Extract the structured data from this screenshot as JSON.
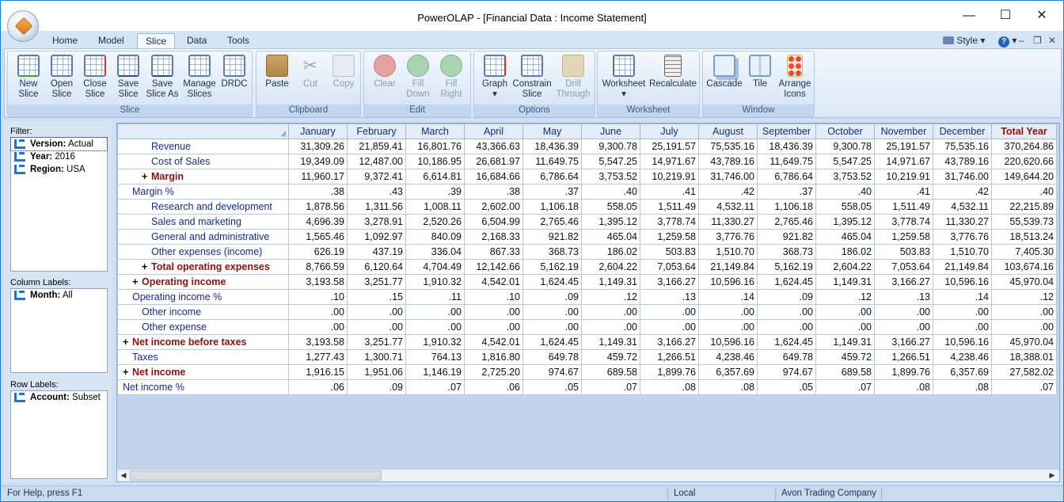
{
  "window": {
    "title": "PowerOLAP - [Financial Data : Income Statement]"
  },
  "tabs": [
    "Home",
    "Model",
    "Slice",
    "Data",
    "Tools"
  ],
  "active_tab": "Slice",
  "ribbon_right": {
    "style_label": "Style"
  },
  "ribbon": {
    "slice": {
      "label": "Slice",
      "buttons": [
        "New Slice",
        "Open Slice",
        "Close Slice",
        "Save Slice",
        "Save Slice As",
        "Manage Slices",
        "DRDC"
      ]
    },
    "clipboard": {
      "label": "Clipboard",
      "buttons": [
        "Paste",
        "Cut",
        "Copy"
      ]
    },
    "edit": {
      "label": "Edit",
      "buttons": [
        "Clear",
        "Fill Down",
        "Fill Right"
      ]
    },
    "options": {
      "label": "Options",
      "buttons": [
        "Graph",
        "Constrain Slice",
        "Drill Through"
      ]
    },
    "worksheet": {
      "label": "Worksheet",
      "buttons": [
        "Worksheet",
        "Recalculate"
      ]
    },
    "window": {
      "label": "Window",
      "buttons": [
        "Cascade",
        "Tile",
        "Arrange Icons"
      ]
    }
  },
  "panel": {
    "filter_label": "Filter:",
    "filters": [
      {
        "name": "Version:",
        "value": "Actual"
      },
      {
        "name": "Year:",
        "value": "2016"
      },
      {
        "name": "Region:",
        "value": "USA"
      }
    ],
    "column_label": "Column Labels:",
    "columns": [
      {
        "name": "Month:",
        "value": "All"
      }
    ],
    "row_label": "Row Labels:",
    "rows": [
      {
        "name": "Account:",
        "value": "Subset"
      }
    ]
  },
  "grid": {
    "headers": [
      "January",
      "February",
      "March",
      "April",
      "May",
      "June",
      "July",
      "August",
      "September",
      "October",
      "November",
      "December",
      "Total Year"
    ],
    "rows": [
      {
        "label": "Revenue",
        "indent": 3,
        "bold": false,
        "exp": false,
        "values": [
          "31,309.26",
          "21,859.41",
          "16,801.76",
          "43,366.63",
          "18,436.39",
          "9,300.78",
          "25,191.57",
          "75,535.16",
          "18,436.39",
          "9,300.78",
          "25,191.57",
          "75,535.16",
          "370,264.86"
        ]
      },
      {
        "label": "Cost of Sales",
        "indent": 3,
        "bold": false,
        "exp": false,
        "values": [
          "19,349.09",
          "12,487.00",
          "10,186.95",
          "26,681.97",
          "11,649.75",
          "5,547.25",
          "14,971.67",
          "43,789.16",
          "11,649.75",
          "5,547.25",
          "14,971.67",
          "43,789.16",
          "220,620.66"
        ]
      },
      {
        "label": "Margin",
        "indent": 2,
        "bold": true,
        "exp": true,
        "values": [
          "11,960.17",
          "9,372.41",
          "6,614.81",
          "16,684.66",
          "6,786.64",
          "3,753.52",
          "10,219.91",
          "31,746.00",
          "6,786.64",
          "3,753.52",
          "10,219.91",
          "31,746.00",
          "149,644.20"
        ]
      },
      {
        "label": "Margin %",
        "indent": 1,
        "bold": false,
        "exp": false,
        "values": [
          ".38",
          ".43",
          ".39",
          ".38",
          ".37",
          ".40",
          ".41",
          ".42",
          ".37",
          ".40",
          ".41",
          ".42",
          ".40"
        ]
      },
      {
        "label": "Research and development",
        "indent": 3,
        "bold": false,
        "exp": false,
        "values": [
          "1,878.56",
          "1,311.56",
          "1,008.11",
          "2,602.00",
          "1,106.18",
          "558.05",
          "1,511.49",
          "4,532.11",
          "1,106.18",
          "558.05",
          "1,511.49",
          "4,532.11",
          "22,215.89"
        ]
      },
      {
        "label": "Sales and marketing",
        "indent": 3,
        "bold": false,
        "exp": false,
        "values": [
          "4,696.39",
          "3,278.91",
          "2,520.26",
          "6,504.99",
          "2,765.46",
          "1,395.12",
          "3,778.74",
          "11,330.27",
          "2,765.46",
          "1,395.12",
          "3,778.74",
          "11,330.27",
          "55,539.73"
        ]
      },
      {
        "label": "General and administrative",
        "indent": 3,
        "bold": false,
        "exp": false,
        "values": [
          "1,565.46",
          "1,092.97",
          "840.09",
          "2,168.33",
          "921.82",
          "465.04",
          "1,259.58",
          "3,776.76",
          "921.82",
          "465.04",
          "1,259.58",
          "3,776.76",
          "18,513.24"
        ]
      },
      {
        "label": "Other expenses (income)",
        "indent": 3,
        "bold": false,
        "exp": false,
        "values": [
          "626.19",
          "437.19",
          "336.04",
          "867.33",
          "368.73",
          "186.02",
          "503.83",
          "1,510.70",
          "368.73",
          "186.02",
          "503.83",
          "1,510.70",
          "7,405.30"
        ]
      },
      {
        "label": "Total operating expenses",
        "indent": 2,
        "bold": true,
        "exp": true,
        "values": [
          "8,766.59",
          "6,120.64",
          "4,704.49",
          "12,142.66",
          "5,162.19",
          "2,604.22",
          "7,053.64",
          "21,149.84",
          "5,162.19",
          "2,604.22",
          "7,053.64",
          "21,149.84",
          "103,674.16"
        ]
      },
      {
        "label": "Operating income",
        "indent": 1,
        "bold": true,
        "exp": true,
        "values": [
          "3,193.58",
          "3,251.77",
          "1,910.32",
          "4,542.01",
          "1,624.45",
          "1,149.31",
          "3,166.27",
          "10,596.16",
          "1,624.45",
          "1,149.31",
          "3,166.27",
          "10,596.16",
          "45,970.04"
        ]
      },
      {
        "label": "Operating income %",
        "indent": 1,
        "bold": false,
        "exp": false,
        "values": [
          ".10",
          ".15",
          ".11",
          ".10",
          ".09",
          ".12",
          ".13",
          ".14",
          ".09",
          ".12",
          ".13",
          ".14",
          ".12"
        ]
      },
      {
        "label": "Other income",
        "indent": 2,
        "bold": false,
        "exp": false,
        "values": [
          ".00",
          ".00",
          ".00",
          ".00",
          ".00",
          ".00",
          ".00",
          ".00",
          ".00",
          ".00",
          ".00",
          ".00",
          ".00"
        ]
      },
      {
        "label": "Other expense",
        "indent": 2,
        "bold": false,
        "exp": false,
        "values": [
          ".00",
          ".00",
          ".00",
          ".00",
          ".00",
          ".00",
          ".00",
          ".00",
          ".00",
          ".00",
          ".00",
          ".00",
          ".00"
        ]
      },
      {
        "label": "Net income before taxes",
        "indent": 0,
        "bold": true,
        "exp": true,
        "values": [
          "3,193.58",
          "3,251.77",
          "1,910.32",
          "4,542.01",
          "1,624.45",
          "1,149.31",
          "3,166.27",
          "10,596.16",
          "1,624.45",
          "1,149.31",
          "3,166.27",
          "10,596.16",
          "45,970.04"
        ]
      },
      {
        "label": "Taxes",
        "indent": 1,
        "bold": false,
        "exp": false,
        "values": [
          "1,277.43",
          "1,300.71",
          "764.13",
          "1,816.80",
          "649.78",
          "459.72",
          "1,266.51",
          "4,238.46",
          "649.78",
          "459.72",
          "1,266.51",
          "4,238.46",
          "18,388.01"
        ]
      },
      {
        "label": "Net income",
        "indent": 0,
        "bold": true,
        "exp": true,
        "values": [
          "1,916.15",
          "1,951.06",
          "1,146.19",
          "2,725.20",
          "974.67",
          "689.58",
          "1,899.76",
          "6,357.69",
          "974.67",
          "689.58",
          "1,899.76",
          "6,357.69",
          "27,582.02"
        ]
      },
      {
        "label": "Net income %",
        "indent": 0,
        "bold": false,
        "exp": false,
        "values": [
          ".06",
          ".09",
          ".07",
          ".06",
          ".05",
          ".07",
          ".08",
          ".08",
          ".05",
          ".07",
          ".08",
          ".08",
          ".07"
        ]
      }
    ]
  },
  "status": {
    "help": "For Help, press F1",
    "mode": "Local",
    "company": "Avon Trading Company"
  }
}
